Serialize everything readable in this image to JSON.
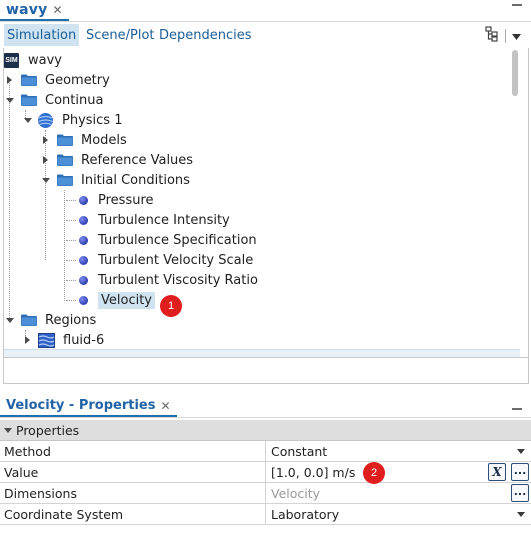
{
  "top_panel": {
    "tab_label": "wavy",
    "close_glyph": "✕",
    "subtabs": [
      "Simulation",
      "Scene/Plot",
      "Dependencies"
    ],
    "icons": [
      "tree-options-icon",
      "chevron-down-icon"
    ]
  },
  "tree": {
    "root": {
      "badge": "SIM",
      "label": "wavy"
    },
    "geometry": "Geometry",
    "continua": "Continua",
    "physics": "Physics 1",
    "models": "Models",
    "reference_values": "Reference Values",
    "initial_conditions": "Initial Conditions",
    "ic_items": [
      "Pressure",
      "Turbulence Intensity",
      "Turbulence Specification",
      "Turbulent Velocity Scale",
      "Turbulent Viscosity Ratio",
      "Velocity"
    ],
    "regions": "Regions",
    "fluid": "fluid-6",
    "selected": "Velocity"
  },
  "badges": {
    "one": "1",
    "two": "2"
  },
  "properties_panel": {
    "tab_label": "Velocity - Properties",
    "close_glyph": "✕",
    "section": "Properties",
    "rows": [
      {
        "name": "Method",
        "value": "Constant"
      },
      {
        "name": "Value",
        "value": "[1.0, 0.0] m/s"
      },
      {
        "name": "Dimensions",
        "value": "Velocity"
      },
      {
        "name": "Coordinate System",
        "value": "Laboratory"
      }
    ],
    "expr_button": "X",
    "ellipsis_button": "..."
  },
  "colors": {
    "accent": "#2262a6",
    "selection": "#cfe3f1",
    "badge": "#e01e1e"
  }
}
